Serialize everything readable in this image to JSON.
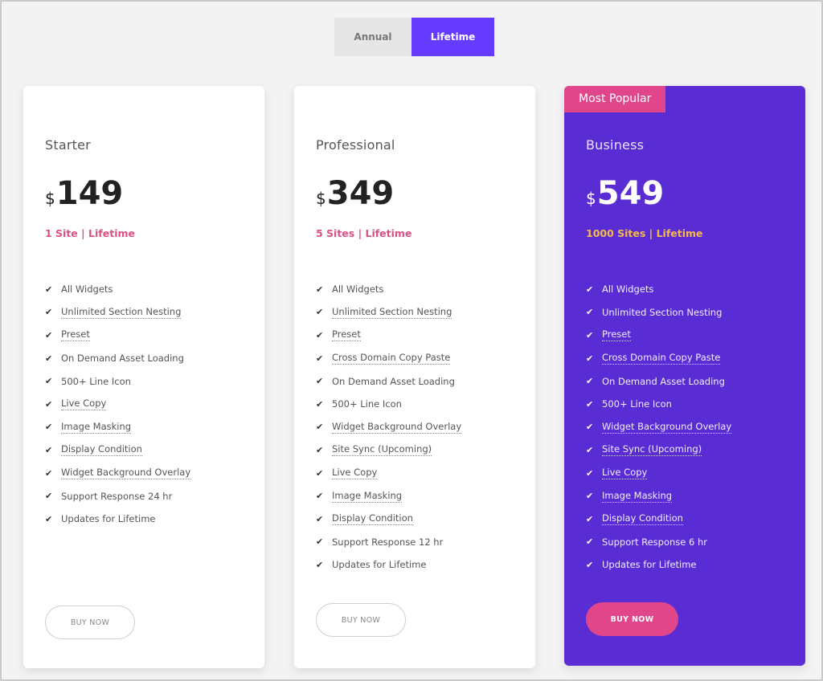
{
  "billing_toggle": {
    "options": [
      {
        "label": "Annual",
        "active": false
      },
      {
        "label": "Lifetime",
        "active": true
      }
    ]
  },
  "colors": {
    "accent": "#653cff",
    "featured_card": "#5a2cd3",
    "pink": "#e1468a",
    "gold": "#f5b94f"
  },
  "plans": [
    {
      "name": "Starter",
      "currency": "$",
      "price": "149",
      "sites": "1 Site | Lifetime",
      "badge": null,
      "features": [
        {
          "text": "All Widgets",
          "tooltip": false
        },
        {
          "text": "Unlimited Section Nesting",
          "tooltip": true
        },
        {
          "text": "Preset",
          "tooltip": true
        },
        {
          "text": "On Demand Asset Loading",
          "tooltip": false
        },
        {
          "text": "500+ Line Icon",
          "tooltip": false
        },
        {
          "text": "Live Copy",
          "tooltip": true
        },
        {
          "text": "Image Masking",
          "tooltip": true
        },
        {
          "text": "Display Condition",
          "tooltip": true
        },
        {
          "text": "Widget Background Overlay",
          "tooltip": true
        },
        {
          "text": "Support Response 24 hr",
          "tooltip": false
        },
        {
          "text": "Updates for Lifetime",
          "tooltip": false
        }
      ],
      "button": "BUY NOW"
    },
    {
      "name": "Professional",
      "currency": "$",
      "price": "349",
      "sites": "5 Sites | Lifetime",
      "badge": null,
      "features": [
        {
          "text": "All Widgets",
          "tooltip": false
        },
        {
          "text": "Unlimited Section Nesting",
          "tooltip": true
        },
        {
          "text": "Preset",
          "tooltip": true
        },
        {
          "text": "Cross Domain Copy Paste",
          "tooltip": true
        },
        {
          "text": "On Demand Asset Loading",
          "tooltip": false
        },
        {
          "text": "500+ Line Icon",
          "tooltip": false
        },
        {
          "text": "Widget Background Overlay",
          "tooltip": true
        },
        {
          "text": "Site Sync (Upcoming)",
          "tooltip": true
        },
        {
          "text": "Live Copy",
          "tooltip": true
        },
        {
          "text": "Image Masking",
          "tooltip": true
        },
        {
          "text": "Display Condition",
          "tooltip": true
        },
        {
          "text": "Support Response 12 hr",
          "tooltip": false
        },
        {
          "text": "Updates for Lifetime",
          "tooltip": false
        }
      ],
      "button": "BUY NOW"
    },
    {
      "name": "Business",
      "currency": "$",
      "price": "549",
      "sites": "1000 Sites | Lifetime",
      "badge": "Most Popular",
      "features": [
        {
          "text": "All Widgets",
          "tooltip": false
        },
        {
          "text": "Unlimited Section Nesting",
          "tooltip": false
        },
        {
          "text": "Preset",
          "tooltip": true
        },
        {
          "text": "Cross Domain Copy Paste",
          "tooltip": true
        },
        {
          "text": "On Demand Asset Loading",
          "tooltip": false
        },
        {
          "text": "500+ Line Icon",
          "tooltip": false
        },
        {
          "text": "Widget Background Overlay",
          "tooltip": true
        },
        {
          "text": "Site Sync (Upcoming)",
          "tooltip": true
        },
        {
          "text": "Live Copy",
          "tooltip": true
        },
        {
          "text": "Image Masking",
          "tooltip": true
        },
        {
          "text": "Display Condition",
          "tooltip": true
        },
        {
          "text": "Support Response 6 hr",
          "tooltip": false
        },
        {
          "text": "Updates for Lifetime",
          "tooltip": false
        }
      ],
      "button": "BUY NOW"
    }
  ]
}
